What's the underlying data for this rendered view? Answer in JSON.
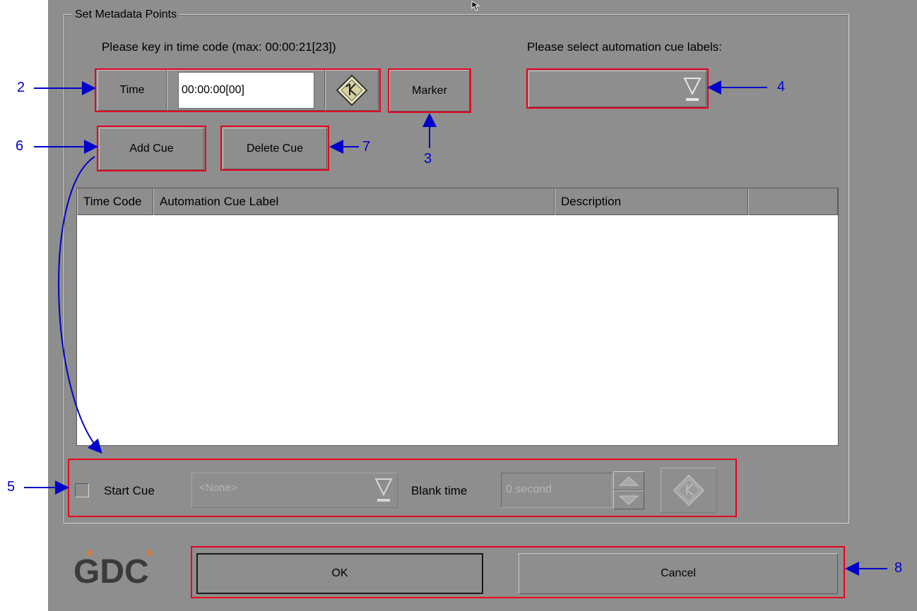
{
  "group": {
    "title": "Set Metadata Points"
  },
  "timecode": {
    "prompt": "Please key in time code (max: 00:00:21[23])",
    "time_label": "Time",
    "value": "00:00:00[00]",
    "marker_label": "Marker"
  },
  "cue_labels": {
    "prompt": "Please select automation cue labels:",
    "selected": ""
  },
  "buttons": {
    "add_cue": "Add Cue",
    "delete_cue": "Delete Cue",
    "ok": "OK",
    "cancel": "Cancel"
  },
  "table": {
    "columns": [
      "Time Code",
      "Automation Cue Label",
      "Description",
      ""
    ],
    "rows": []
  },
  "start_cue": {
    "checkbox_label": "Start Cue",
    "checked": false,
    "select_value": "<None>",
    "blank_time_label": "Blank time",
    "blank_time_value": "0 second"
  },
  "logo": {
    "text": "GDC",
    "color": "#3a3a3a",
    "accent": "#e8772e"
  },
  "annotations": [
    "2",
    "3",
    "4",
    "5",
    "6",
    "7",
    "8"
  ],
  "colors": {
    "panel": "#8e8e8e",
    "highlight": "#e8001c",
    "annotation": "#0000cc"
  }
}
